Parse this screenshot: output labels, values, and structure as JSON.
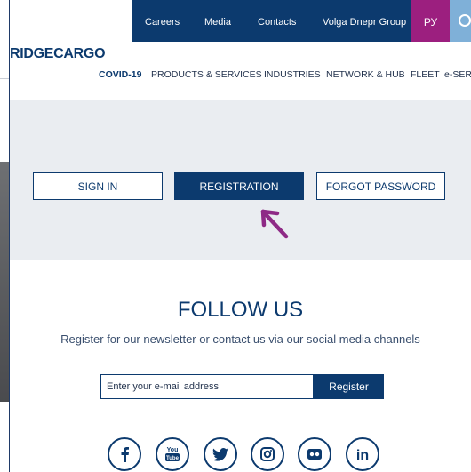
{
  "topbar": {
    "links": [
      "Careers",
      "Media",
      "Contacts",
      "Volga Dnepr Group"
    ],
    "language": "РУ"
  },
  "logo": "RIDGECARGO",
  "mainnav": [
    "COVID-19",
    "PRODUCTS & SERVICES",
    "INDUSTRIES",
    "NETWORK & HUB",
    "FLEET",
    "e-SER"
  ],
  "account": {
    "sign_in": "SIGN IN",
    "registration": "REGISTRATION",
    "forgot_password": "FORGOT PASSWORD"
  },
  "follow": {
    "title": "FOLLOW US",
    "subtitle": "Register for our newsletter or contact us via our social media channels",
    "email_placeholder": "Enter your e-mail address",
    "register_label": "Register"
  },
  "social_icons": [
    "facebook-icon",
    "youtube-icon",
    "twitter-icon",
    "instagram-icon",
    "flickr-icon",
    "linkedin-icon"
  ],
  "colors": {
    "brand_navy": "#0c3a6e",
    "language_magenta": "#9c1f7f",
    "search_light_blue": "#7fb0d8",
    "annotation_arrow": "#8e2a86"
  }
}
